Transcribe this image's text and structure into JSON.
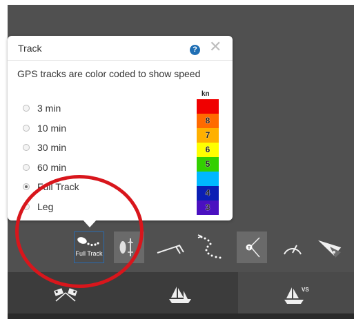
{
  "popup": {
    "title": "Track",
    "help_label": "?",
    "close_label": "✕",
    "description": "GPS tracks are color coded to show speed",
    "options": [
      {
        "label": "3 min",
        "checked": false
      },
      {
        "label": "10 min",
        "checked": false
      },
      {
        "label": "30 min",
        "checked": false
      },
      {
        "label": "60 min",
        "checked": false
      },
      {
        "label": "Full Track",
        "checked": true
      },
      {
        "label": "Leg",
        "checked": false
      }
    ]
  },
  "speed_scale": {
    "unit": "kn",
    "bands": [
      {
        "color": "#f00000",
        "label": ""
      },
      {
        "color": "#ff6a00",
        "label": "8"
      },
      {
        "color": "#ffb000",
        "label": "7"
      },
      {
        "color": "#ffff00",
        "label": "6"
      },
      {
        "color": "#33d000",
        "label": "5"
      },
      {
        "color": "#00b8ff",
        "label": ""
      },
      {
        "color": "#0a1eb4",
        "label": "4"
      },
      {
        "color": "#4a10c0",
        "label": "3"
      }
    ]
  },
  "toolbar": {
    "full_track_label": "Full Track",
    "tools": [
      "full-track-icon",
      "fleet-spacing-icon",
      "wind-barb-icon",
      "route-icon",
      "course-compass-icon",
      "speedometer-icon",
      "pennant-icon"
    ]
  },
  "bottom_tabs": [
    "race-flags-icon",
    "fleet-boat-icon",
    "vs-boat-icon"
  ],
  "bottom_tab_badge": "VS",
  "colors": {
    "annotation_circle": "#d8161c",
    "selected_border": "#2b6cb0",
    "map_background": "#505050"
  }
}
